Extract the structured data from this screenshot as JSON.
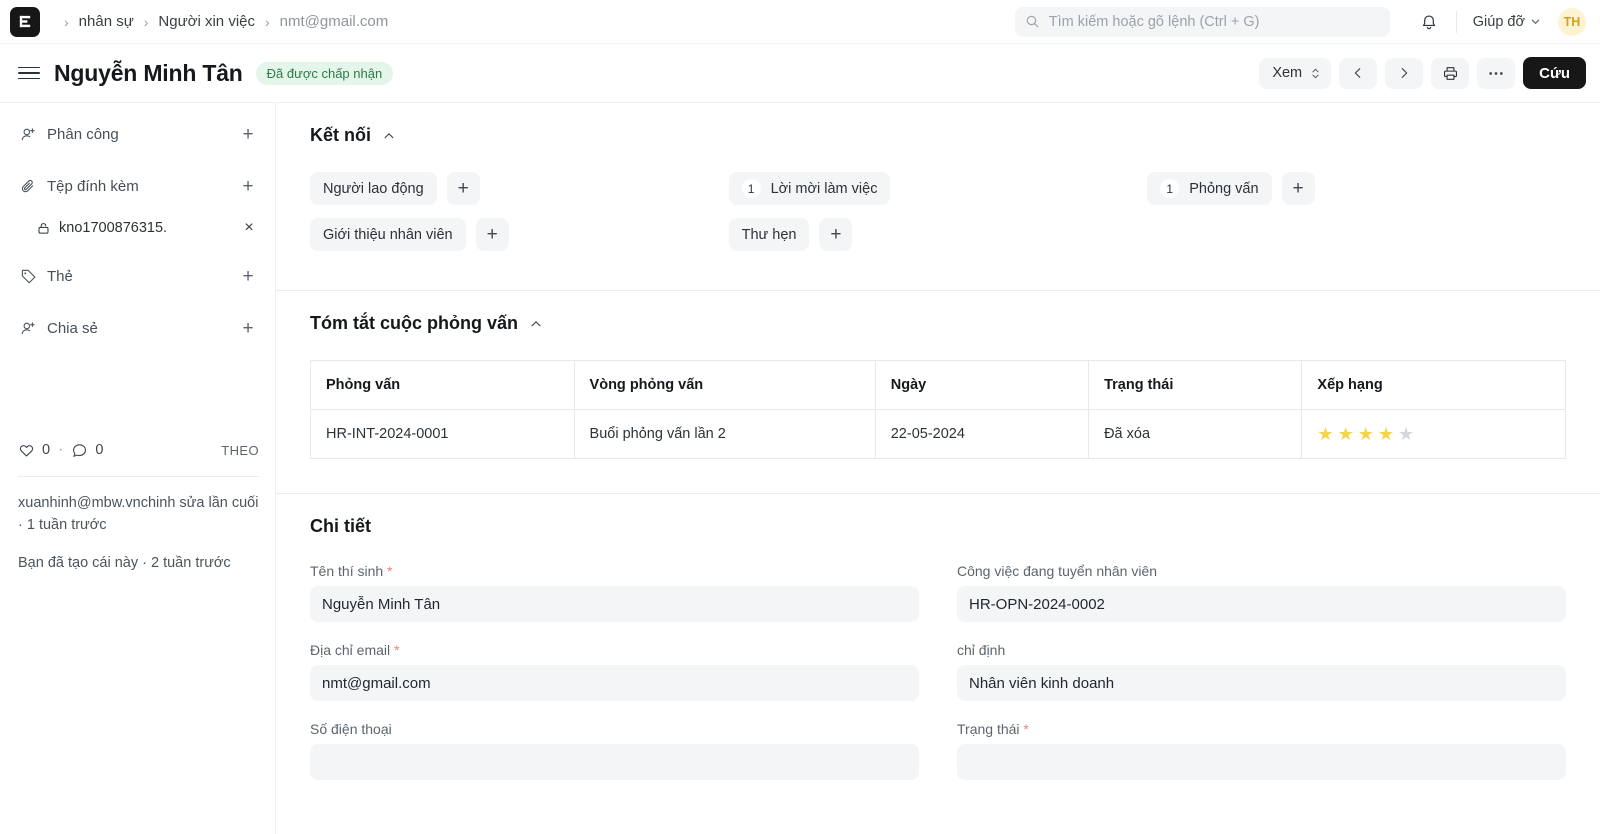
{
  "navbar": {
    "logo_icon": "frappe-e-logo",
    "breadcrumbs": [
      {
        "label": "nhân sự",
        "muted": false
      },
      {
        "label": "Người xin việc",
        "muted": false
      },
      {
        "label": "nmt@gmail.com",
        "muted": true
      }
    ],
    "separator": "›",
    "search": {
      "placeholder": "Tìm kiếm hoặc gõ lệnh (Ctrl + G)",
      "value": "",
      "icon": "search-icon"
    },
    "notification_icon": "bell-icon",
    "help_label": "Giúp đỡ",
    "help_chevron": "chevron-down-icon",
    "avatar_initials": "TH"
  },
  "pagehead": {
    "menu_icon": "hamburger-icon",
    "title": "Nguyễn Minh Tân",
    "status_badge": "Đã được chấp nhận",
    "badge_bg": "#e4f5e9",
    "badge_fg": "#2c7a4b",
    "view_label": "Xem",
    "view_icon": "updown-chevron-icon",
    "prev_icon": "chevron-left-icon",
    "next_icon": "chevron-right-icon",
    "print_icon": "printer-icon",
    "more_icon": "ellipsis-icon",
    "save_label": "Cứu"
  },
  "sidebar": {
    "items": [
      {
        "label": "Phân công",
        "icon": "assign-user-icon",
        "add": "+"
      },
      {
        "label": "Tệp đính kèm",
        "icon": "paperclip-icon",
        "add": "+"
      },
      {
        "label": "Thẻ",
        "icon": "tag-icon",
        "add": "+"
      },
      {
        "label": "Chia sẻ",
        "icon": "share-user-icon",
        "add": "+"
      }
    ],
    "attachment": {
      "name": "kno1700876315.",
      "icon": "lock-icon",
      "remove": "×"
    },
    "stats": {
      "like_icon": "heart-icon",
      "like_count": "0",
      "separator": "·",
      "comment_icon": "comment-icon",
      "comment_count": "0",
      "follow_label": "THEO"
    },
    "modified_text": "xuanhinh@mbw.vnchinh sửa lần cuối · 1 tuần trước",
    "created_text": "Bạn đã tạo cái này · 2 tuần trước"
  },
  "connections": {
    "title": "Kết nối",
    "collapse_icon": "chevron-up-icon",
    "columns": [
      [
        {
          "label": "Người lao động",
          "count": null,
          "has_add": true
        },
        {
          "label": "Giới thiệu nhân viên",
          "count": null,
          "has_add": true
        }
      ],
      [
        {
          "label": "Lời mời làm việc",
          "count": "1",
          "has_add": false
        },
        {
          "label": "Thư hẹn",
          "count": null,
          "has_add": true
        }
      ],
      [
        {
          "label": "Phỏng vấn",
          "count": "1",
          "has_add": true
        }
      ]
    ]
  },
  "interview_summary": {
    "title": "Tóm tắt cuộc phỏng vấn",
    "collapse_icon": "chevron-up-icon",
    "columns": [
      "Phỏng vấn",
      "Vòng phỏng vấn",
      "Ngày",
      "Trạng thái",
      "Xếp hạng"
    ],
    "rows": [
      {
        "interview": "HR-INT-2024-0001",
        "round": "Buổi phỏng vấn lần 2",
        "date": "22-05-2024",
        "status": "Đã xóa",
        "rating": 4,
        "rating_max": 5
      }
    ],
    "star_filled_color": "#f5d44c",
    "star_empty_color": "#d4d7da"
  },
  "details": {
    "title": "Chi tiết",
    "left_fields": [
      {
        "label": "Tên thí sinh",
        "required": true,
        "value": "Nguyễn Minh Tân"
      },
      {
        "label": "Địa chỉ email",
        "required": true,
        "value": "nmt@gmail.com"
      },
      {
        "label": "Số điện thoại",
        "required": false,
        "value": ""
      }
    ],
    "right_fields": [
      {
        "label": "Công việc đang tuyển nhân viên",
        "required": false,
        "value": "HR-OPN-2024-0002"
      },
      {
        "label": "chỉ định",
        "required": false,
        "value": "Nhân viên kinh doanh"
      },
      {
        "label": "Trạng thái",
        "required": true,
        "value": ""
      }
    ]
  }
}
